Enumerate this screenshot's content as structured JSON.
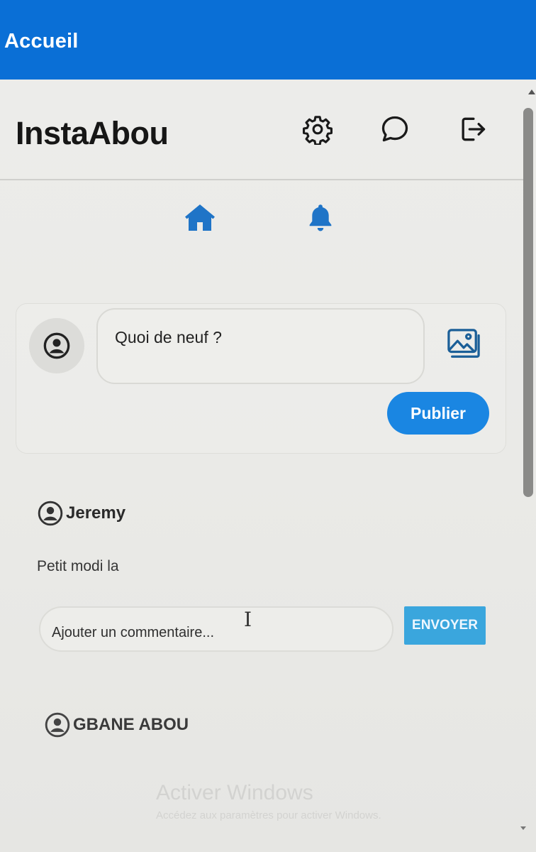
{
  "window": {
    "title": "Accueil",
    "titlebar_color": "#0a6fd6"
  },
  "app": {
    "brand": "InstaAbou",
    "accent_color": "#1a86e2"
  },
  "header_icons": [
    "gear-icon",
    "chat-bubble-icon",
    "logout-icon"
  ],
  "nav_icons": [
    "home-icon",
    "bell-icon"
  ],
  "composer": {
    "placeholder": "Quoi de neuf ?",
    "image_icon": "image-icon",
    "publish_label": "Publier"
  },
  "posts": [
    {
      "author": "Jeremy",
      "text": "Petit modi la",
      "comment_placeholder": "Ajouter un commentaire...",
      "send_label": "ENVOYER"
    },
    {
      "author": "GBANE ABOU"
    }
  ],
  "watermark": {
    "title": "Activer Windows",
    "subtitle": "Accédez aux paramètres pour activer Windows."
  }
}
